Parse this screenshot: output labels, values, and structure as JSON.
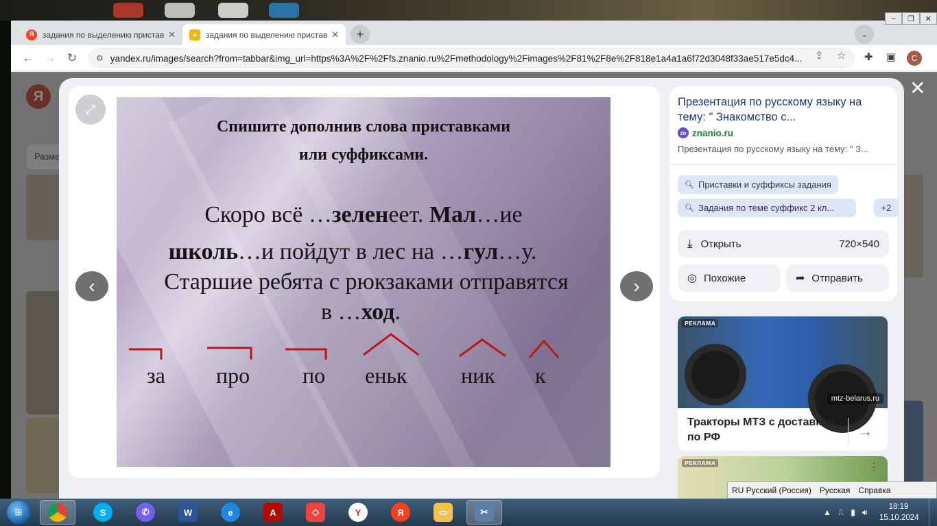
{
  "browser": {
    "tabs": [
      {
        "label": "задания по выделению пристав",
        "favicon": "Я",
        "active": false
      },
      {
        "label": "задания по выделению пристав",
        "favicon": "img",
        "active": true
      }
    ],
    "new_tab": "+",
    "tab_menu": "⌄",
    "url": "yandex.ru/images/search?from=tabbar&img_url=https%3A%2F%2Ffs.znanio.ru%2Fmethodology%2Fimages%2F81%2F8e%2F818e1a4a1a6f72d3048f33ae517e5dc4...",
    "profile_initial": "C"
  },
  "background_page": {
    "logo": "Я",
    "size_filter": "Разме"
  },
  "slide": {
    "title_line1": "Спишите дополнив  слова приставками",
    "title_line2": "или суффиксами.",
    "sentence": [
      {
        "text": "Скоро всё …",
        "bold": false
      },
      {
        "text": "зелен",
        "bold": true
      },
      {
        "text": "еет. ",
        "bold": false
      },
      {
        "text": "Мал",
        "bold": true
      },
      {
        "text": "…ие",
        "bold": false
      }
    ],
    "sentence2": [
      {
        "text": "школь",
        "bold": true
      },
      {
        "text": "…и пойдут в лес на …",
        "bold": false
      },
      {
        "text": "гул",
        "bold": true
      },
      {
        "text": "…у.",
        "bold": false
      }
    ],
    "sentence3": "Старшие ребята с рюкзаками отправятся",
    "sentence4": [
      {
        "text": "в …",
        "bold": false
      },
      {
        "text": "ход",
        "bold": true
      },
      {
        "text": ".",
        "bold": false
      }
    ],
    "morphemes": [
      {
        "text": "за",
        "mark": "prefix"
      },
      {
        "text": "про",
        "mark": "prefix"
      },
      {
        "text": "по",
        "mark": "prefix"
      },
      {
        "text": "еньк",
        "mark": "suffix"
      },
      {
        "text": "ник",
        "mark": "suffix"
      },
      {
        "text": "к",
        "mark": "suffix"
      }
    ],
    "mark_color": "#c0141c"
  },
  "info": {
    "title": "Презентация по русскому языку на тему: \" Знакомство с...",
    "site": "znanio.ru",
    "description": "Презентация по русскому языку на тему: \" З...",
    "chips": [
      "Приставки и суффиксы задания",
      "Задания по теме суффикс 2 кл..."
    ],
    "chips_more": "+2",
    "open_label": "Открыть",
    "image_size": "720×540",
    "similar_label": "Похожие",
    "share_label": "Отправить"
  },
  "ad": {
    "tag": "РЕКЛАМА",
    "site": "mtz-belarus.ru",
    "title": "Тракторы МТЗ с доставкой по РФ",
    "tag2": "РЕКЛАМА"
  },
  "langbar": {
    "language": "RU Русский (Россия)",
    "layout": "Русская",
    "help": "Справка"
  },
  "taskbar": {
    "time": "18:19",
    "date": "15.10.2024"
  },
  "colors": {
    "accent_link": "#1a3a8e",
    "site_green": "#1a7f37",
    "yandex_red": "#fc3f1d"
  }
}
